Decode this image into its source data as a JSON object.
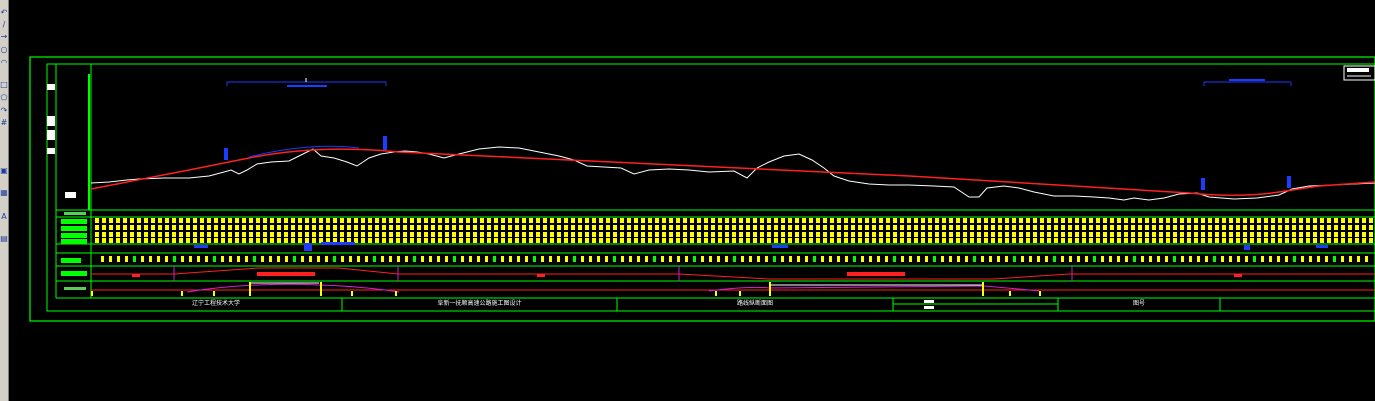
{
  "toolbar": {
    "icons": [
      {
        "name": "undo-icon",
        "glyph": "↶"
      },
      {
        "name": "line-icon",
        "glyph": "/"
      },
      {
        "name": "move-icon",
        "glyph": "→"
      },
      {
        "name": "circle-icon",
        "glyph": "○"
      },
      {
        "name": "arc-icon",
        "glyph": "◠"
      },
      {
        "name": "rectangle-icon",
        "glyph": "□"
      },
      {
        "name": "polygon-icon",
        "glyph": "⬠"
      },
      {
        "name": "redo-icon",
        "glyph": "↷"
      },
      {
        "name": "hatch-icon",
        "glyph": "#"
      },
      {
        "name": "block-icon",
        "glyph": "▣"
      },
      {
        "name": "table-icon",
        "glyph": "▦"
      },
      {
        "name": "text-icon",
        "glyph": "A"
      },
      {
        "name": "layer-icon",
        "glyph": "▤"
      }
    ]
  },
  "titleblock": {
    "school": "辽宁工程技术大学",
    "project": "阜新一抚顺高速公路施工图设计",
    "drawing": "路线纵断面图",
    "scale": "",
    "sheet": "图号"
  },
  "colors": {
    "frame": "#00ff00",
    "design_line": "#ff2020",
    "ground_line": "#ffffff",
    "curve_marks": "#1010ff",
    "grid_ticks": "#ffff00"
  }
}
